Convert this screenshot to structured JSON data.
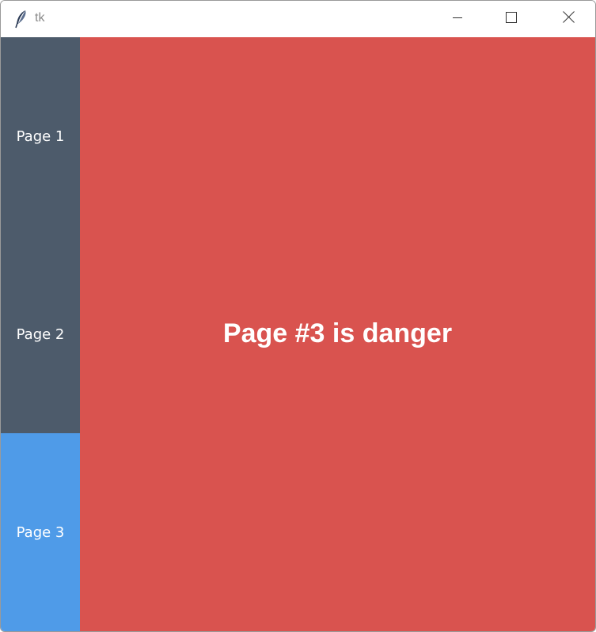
{
  "window": {
    "title": "tk",
    "icon": "feather-icon",
    "controls": {
      "minimize_icon": "minimize-icon",
      "maximize_icon": "maximize-icon",
      "close_icon": "close-icon"
    }
  },
  "sidebar": {
    "inactive_color": "#4d5b6b",
    "active_color": "#4f9be8",
    "items": [
      {
        "label": "Page 1",
        "active": false
      },
      {
        "label": "Page 2",
        "active": false
      },
      {
        "label": "Page 3",
        "active": true
      }
    ]
  },
  "main": {
    "heading": "Page #3 is danger",
    "background_color": "#d9534f",
    "text_color": "#ffffff"
  }
}
